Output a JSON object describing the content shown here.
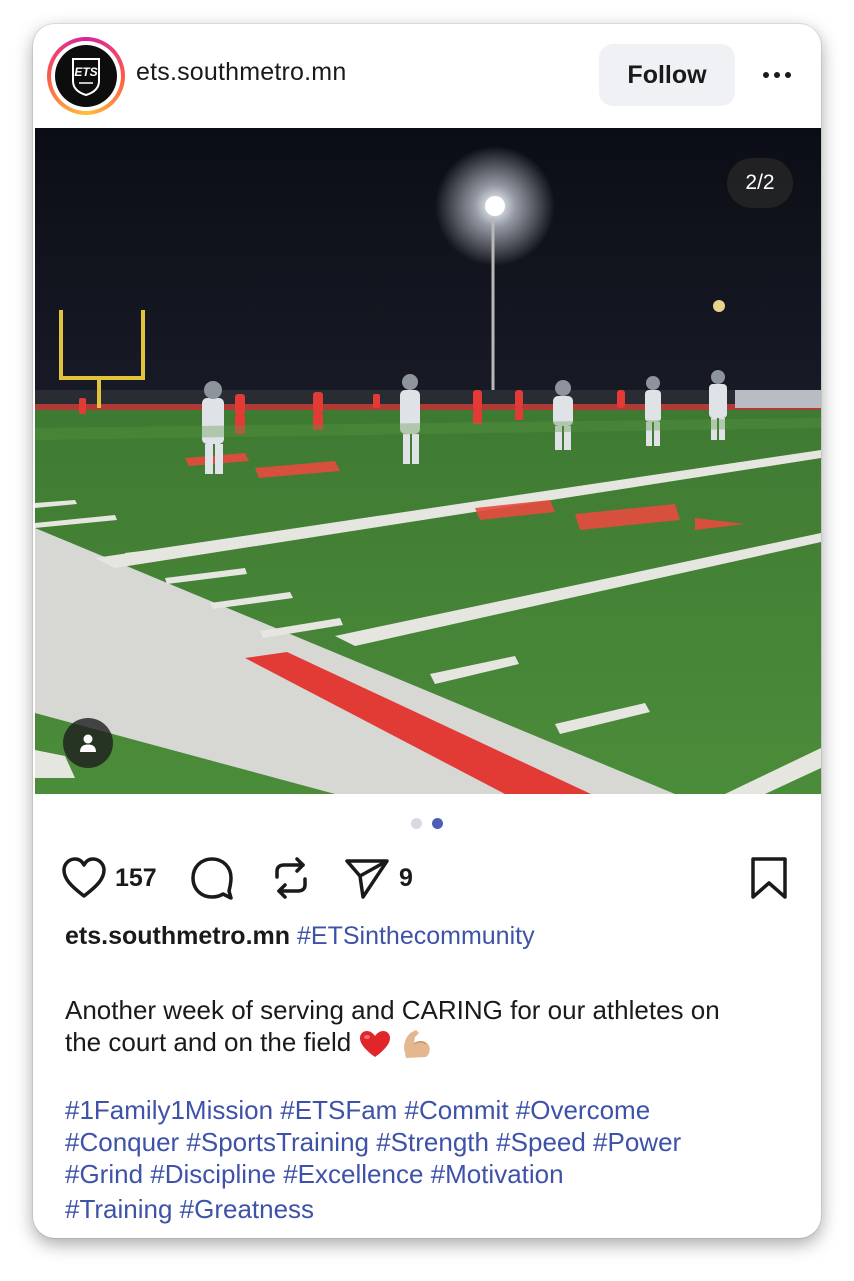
{
  "post": {
    "username": "ets.southmetro.mn",
    "follow_label": "Follow",
    "more_icon": "more-horizontal-icon",
    "image_counter": "2/2",
    "carousel": {
      "total": 2,
      "active_index": 1
    },
    "actions": {
      "like_count": "157",
      "share_count": "9"
    },
    "caption": {
      "username": "ets.southmetro.mn",
      "first_hashtag": "#ETSinthecommunity",
      "text_line1": "Another week of serving and CARING for our athletes on",
      "text_line2": "the court and on the field",
      "emojis": [
        "red-heart",
        "flexed-biceps"
      ],
      "hashtag_lines": [
        "#1Family1Mission #ETSFam #Commit #Overcome",
        "#Conquer #SportsTraining #Strength #Speed #Power",
        "#Grind #Discipline #Excellence #Motivation",
        "#Training #Greatness"
      ]
    },
    "colors": {
      "accent_link": "#3e52a8",
      "active_dot": "#4c5fb5",
      "field_green": "#4f8a3a",
      "end_zone_red": "#e23b36"
    }
  }
}
